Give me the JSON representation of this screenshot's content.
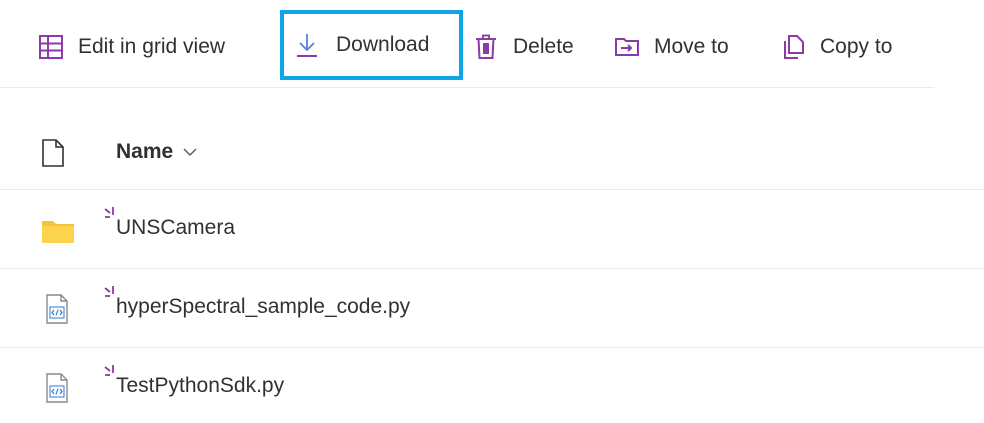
{
  "toolbar": {
    "edit_grid_label": "Edit in grid view",
    "download_label": "Download",
    "delete_label": "Delete",
    "move_label": "Move to",
    "copy_label": "Copy to"
  },
  "list": {
    "name_header": "Name",
    "items": [
      {
        "name": "UNSCamera",
        "type": "folder"
      },
      {
        "name": "hyperSpectral_sample_code.py",
        "type": "python-file"
      },
      {
        "name": "TestPythonSdk.py",
        "type": "python-file"
      }
    ]
  },
  "colors": {
    "accent_purple": "#8b3aa8",
    "highlight_border": "#0ea5e6",
    "folder_yellow": "#f8c03b",
    "download_icon": "#5b7fd6"
  }
}
